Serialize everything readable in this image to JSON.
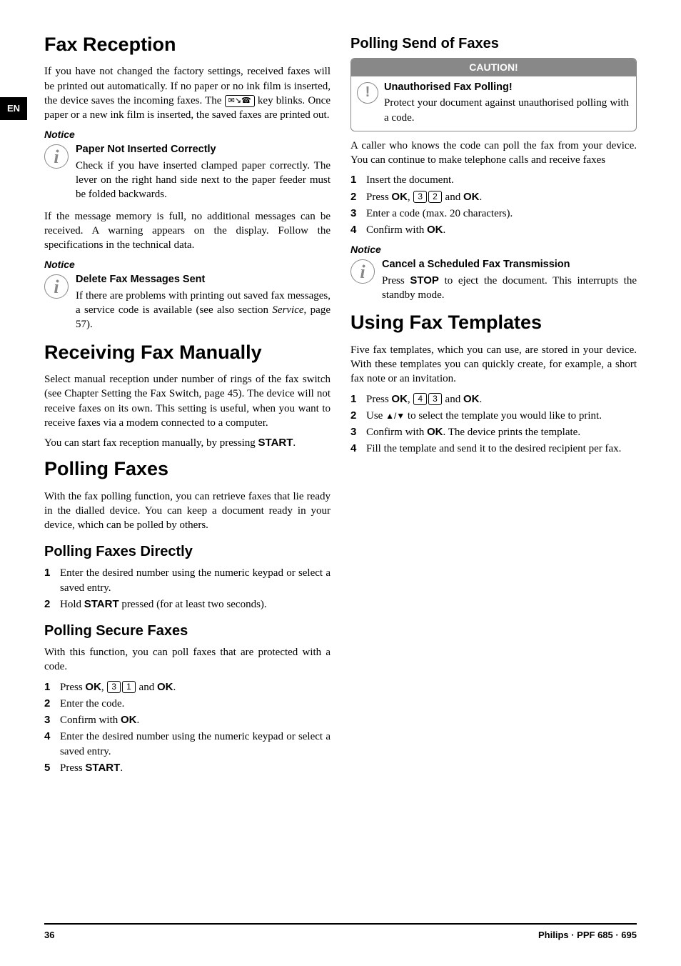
{
  "lang": "EN",
  "left": {
    "h1_fax_reception": "Fax Reception",
    "p_intro1": "If you have not changed the factory settings, received faxes will be printed out automatically. If no paper or no ink film is inserted, the device saves the incoming faxes. The ",
    "p_intro2": " key blinks. Once paper or a new ink film is inserted, the saved faxes are printed out.",
    "notice1": "Notice",
    "note1_title": "Paper Not Inserted Correctly",
    "note1_text": "Check if you have inserted clamped paper correctly. The lever on the right hand side next to the paper feeder must be folded backwards.",
    "p_memfull": "If the message memory is full, no additional messages can be received. A warning appears on the display. Follow the specifications in the technical data.",
    "notice2": "Notice",
    "note2_title": "Delete Fax Messages Sent",
    "note2_text1": "If there are problems with printing out saved fax messages, a service code is available (see also section ",
    "note2_service": "Service",
    "note2_text2": ", page 57).",
    "h1_rx_manual": "Receiving Fax Manually",
    "p_rx_manual": "Select manual reception under number of rings of the fax switch (see Chapter Setting the Fax Switch, page 45). The device will not receive faxes on its own. This setting is useful, when you want to receive faxes via a modem connected to a computer.",
    "p_rx_manual2a": "You can start fax reception manually, by pressing ",
    "p_rx_manual2b": ".",
    "h1_polling": "Polling Faxes",
    "p_polling_intro": "With the fax polling function, you can retrieve faxes that lie ready in the dialled device. You can keep a document ready in your device, which can be polled by others.",
    "h2_poll_direct": "Polling Faxes Directly",
    "poll_direct_s1": "Enter the desired number using the numeric keypad or select a saved entry.",
    "poll_direct_s2a": "Hold ",
    "poll_direct_s2b": " pressed (for at least two seconds).",
    "h2_poll_secure": "Polling Secure Faxes",
    "p_poll_secure": "With this function, you can poll faxes that are protected with a code.",
    "poll_sec_s1a": "Press ",
    "poll_sec_s1b": ", ",
    "poll_sec_s1c": " and ",
    "poll_sec_s1d": ".",
    "poll_sec_s2": "Enter the code.",
    "poll_sec_s3a": "Confirm with ",
    "poll_sec_s3b": ".",
    "poll_sec_s4": "Enter the desired number using the numeric keypad or select a saved entry.",
    "poll_sec_s5a": "Press ",
    "poll_sec_s5b": "."
  },
  "right": {
    "h2_poll_send": "Polling Send of Faxes",
    "caution_label": "CAUTION!",
    "caution_title": "Unauthorised Fax Polling!",
    "caution_text": "Protect your document against unauthorised polling with a code.",
    "p_poll_send": "A caller who knows the code can poll the fax from your device. You can continue to make telephone calls and receive faxes",
    "ps_s1": "Insert the document.",
    "ps_s2a": "Press ",
    "ps_s2b": ", ",
    "ps_s2c": " and ",
    "ps_s2d": ".",
    "ps_s3": "Enter a code (max. 20 characters).",
    "ps_s4a": "Confirm with ",
    "ps_s4b": ".",
    "notice3": "Notice",
    "note3_title": "Cancel a Scheduled Fax Transmission",
    "note3_text1": "Press ",
    "note3_text2": " to eject the document. This interrupts the standby mode.",
    "h1_templates": "Using Fax Templates",
    "p_templates": "Five fax templates, which you can use, are stored in your device. With these templates you can quickly create, for example, a short fax note or an invitation.",
    "t_s1a": "Press ",
    "t_s1b": ", ",
    "t_s1c": " and ",
    "t_s1d": ".",
    "t_s2a": "Use ",
    "t_s2b": " to select the template you would like to print.",
    "t_s3a": "Confirm with ",
    "t_s3b": ". The device prints the template.",
    "t_s4": "Fill the template and send it to the desired recipient per fax."
  },
  "labels": {
    "OK": "OK",
    "START": "START",
    "STOP": "STOP",
    "k1": "1",
    "k2": "2",
    "k3": "3",
    "k4": "4"
  },
  "footer": {
    "page": "36",
    "model": "Philips · PPF 685 · 695"
  }
}
